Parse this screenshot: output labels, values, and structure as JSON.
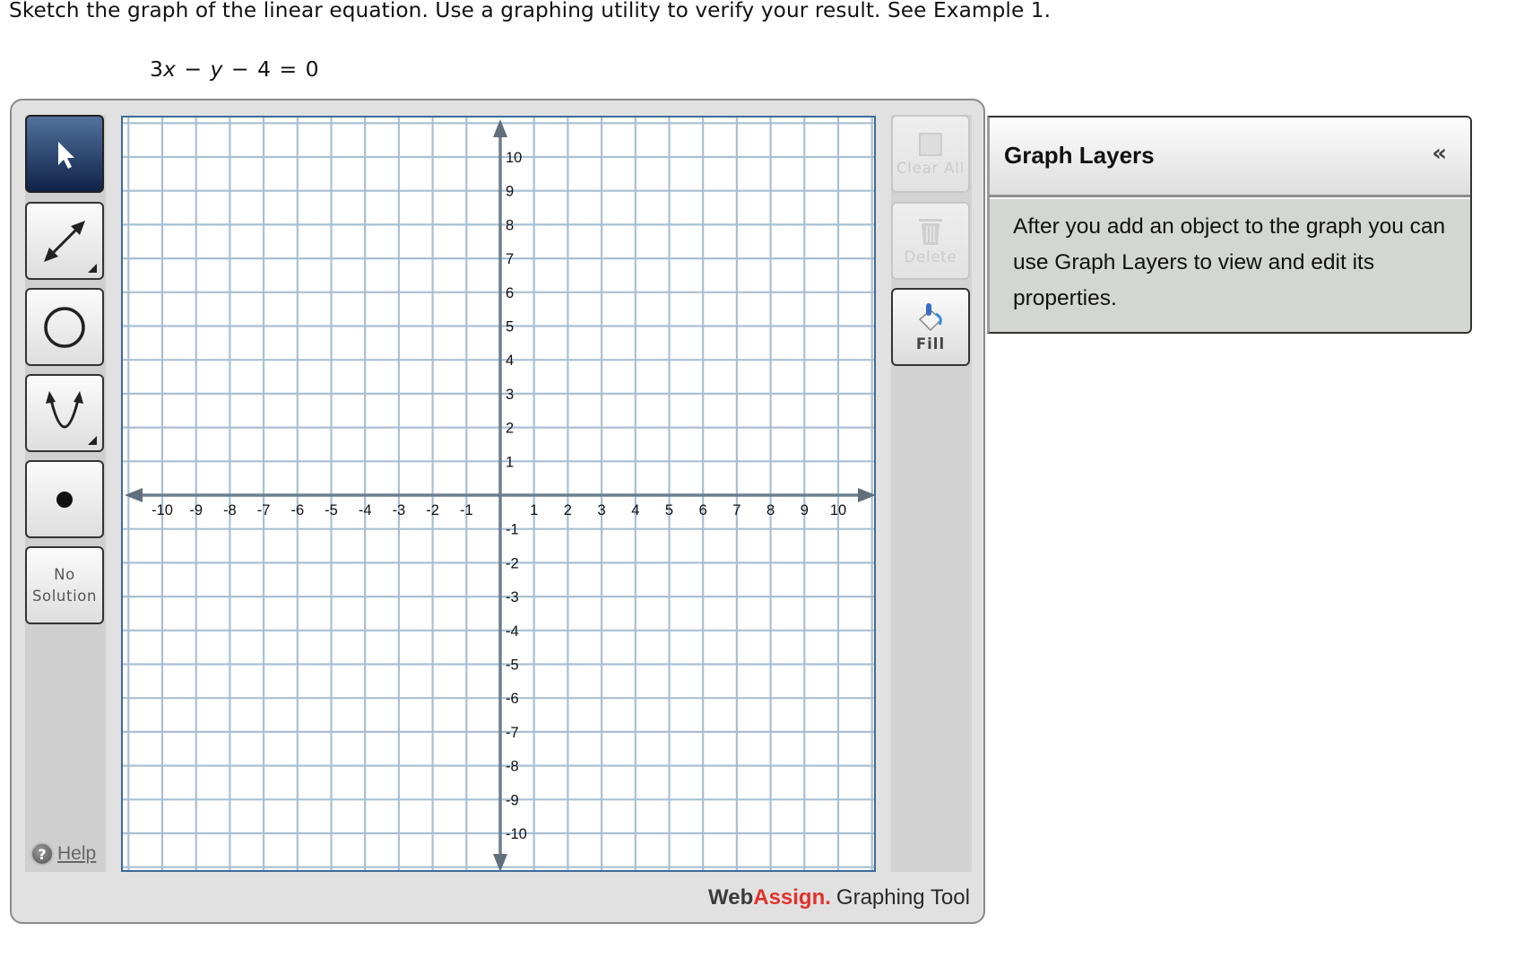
{
  "question": {
    "prompt": "Sketch the graph of the linear equation. Use a graphing utility to verify your result. See Example 1.",
    "equation": {
      "coef": "3",
      "x": "x",
      "minus1": " − ",
      "y": "y",
      "rest": " − 4 = 0"
    }
  },
  "toolbar_left": {
    "tools": [
      {
        "name": "select",
        "icon": "pointer-arrow-icon",
        "active": true
      },
      {
        "name": "line",
        "icon": "double-arrow-line-icon",
        "has_submenu": true
      },
      {
        "name": "circle",
        "icon": "circle-icon"
      },
      {
        "name": "parabola",
        "icon": "parabola-icon",
        "has_submenu": true
      },
      {
        "name": "point",
        "icon": "point-icon"
      }
    ],
    "no_solution_line1": "No",
    "no_solution_line2": "Solution",
    "help_label": "Help"
  },
  "toolbar_right": {
    "clear_all_label": "Clear All",
    "delete_label": "Delete",
    "fill_label": "Fill"
  },
  "graph": {
    "x_range": [
      -11,
      11
    ],
    "y_range": [
      -11,
      11
    ],
    "x_ticks": [
      -10,
      -9,
      -8,
      -7,
      -6,
      -5,
      -4,
      -3,
      -2,
      -1,
      1,
      2,
      3,
      4,
      5,
      6,
      7,
      8,
      9,
      10
    ],
    "y_ticks": [
      10,
      9,
      8,
      7,
      6,
      5,
      4,
      3,
      2,
      1,
      -1,
      -2,
      -3,
      -4,
      -5,
      -6,
      -7,
      -8,
      -9,
      -10
    ],
    "grid_color": "#a9bfd3",
    "axis_color": "#6b7f8f",
    "border_color": "#3d6a9c"
  },
  "branding": {
    "web": "Web",
    "assign": "Assign.",
    "tool": "Graphing Tool"
  },
  "graph_layers": {
    "title": "Graph Layers",
    "collapse_glyph": "«",
    "description": "After you add an object to the graph you can use Graph Layers to view and edit its properties."
  }
}
